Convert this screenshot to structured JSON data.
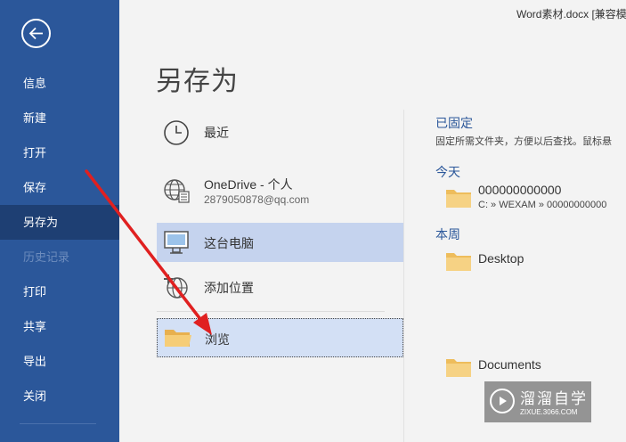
{
  "window": {
    "title": "Word素材.docx [兼容模式"
  },
  "sidebar": {
    "back_icon": "back-arrow-icon",
    "items": [
      {
        "label": "信息",
        "state": "normal"
      },
      {
        "label": "新建",
        "state": "normal"
      },
      {
        "label": "打开",
        "state": "normal"
      },
      {
        "label": "保存",
        "state": "normal"
      },
      {
        "label": "另存为",
        "state": "active"
      },
      {
        "label": "历史记录",
        "state": "disabled"
      },
      {
        "label": "打印",
        "state": "normal"
      },
      {
        "label": "共享",
        "state": "normal"
      },
      {
        "label": "导出",
        "state": "normal"
      },
      {
        "label": "关闭",
        "state": "normal"
      }
    ]
  },
  "main": {
    "title": "另存为",
    "locations": [
      {
        "label": "最近",
        "icon": "clock-icon"
      },
      {
        "label": "OneDrive - 个人",
        "sub": "2879050878@qq.com",
        "icon": "globe-icon"
      },
      {
        "label": "这台电脑",
        "icon": "computer-icon"
      },
      {
        "label": "添加位置",
        "icon": "add-location-icon"
      },
      {
        "label": "浏览",
        "icon": "folder-icon"
      }
    ]
  },
  "right": {
    "pinned": {
      "heading": "已固定",
      "desc": "固定所需文件夹，方便以后查找。鼠标悬"
    },
    "today": {
      "heading": "今天",
      "items": [
        {
          "name": "000000000000",
          "path": "C: » WEXAM » 00000000000"
        }
      ]
    },
    "this_week": {
      "heading": "本周",
      "items": [
        {
          "name": "Desktop"
        }
      ]
    },
    "documents": {
      "name": "Documents"
    }
  },
  "watermark": {
    "title": "溜溜自学",
    "sub": "ZIXUE.3066.COM"
  },
  "colors": {
    "sidebar": "#2b579a",
    "sidebar_active": "#1e3f73",
    "accent": "#2b579a",
    "selection": "#c5d3ee",
    "annotation": "#e02020",
    "folder": "#f3c768"
  }
}
